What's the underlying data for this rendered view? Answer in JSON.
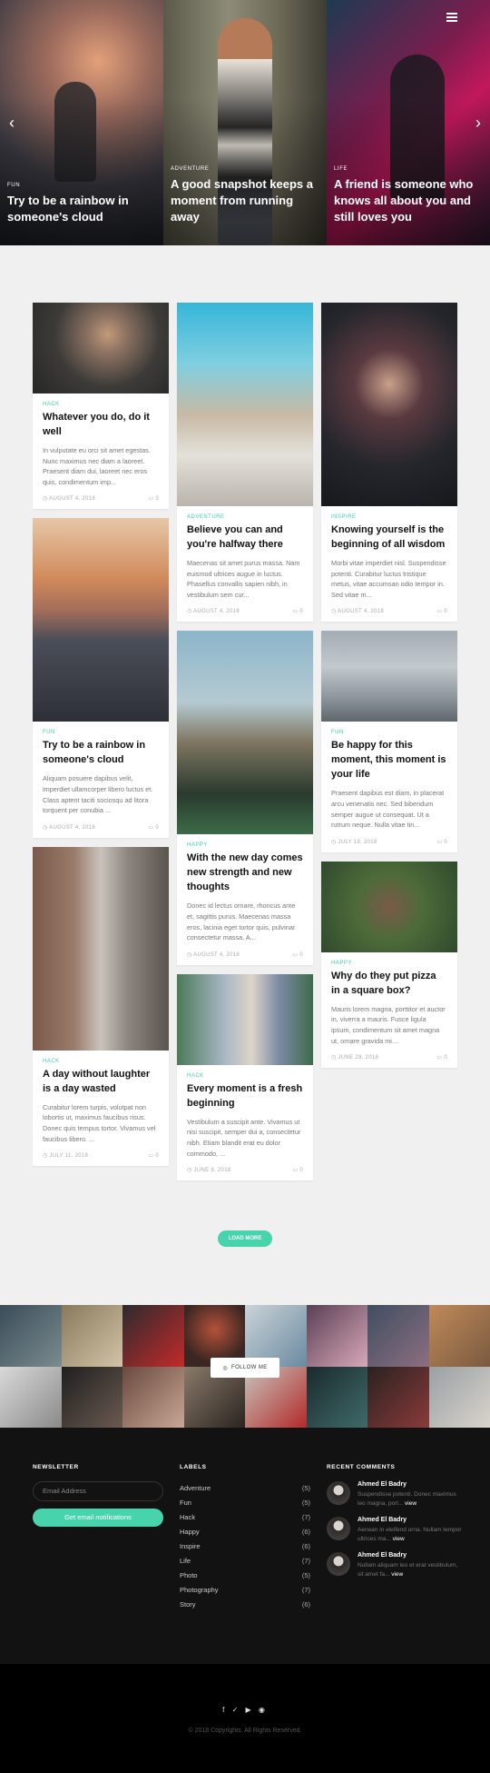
{
  "hero": {
    "slides": [
      {
        "category": "FUN",
        "title": "Try to be a rainbow in someone's cloud"
      },
      {
        "category": "ADVENTURE",
        "title": "A good snapshot keeps a moment from running away"
      },
      {
        "category": "LIFE",
        "title": "A friend is someone who knows all about you and still loves you"
      }
    ],
    "prev": "‹",
    "next": "›"
  },
  "posts": {
    "col1": [
      {
        "category": "HACK",
        "title": "Whatever you do, do it well",
        "excerpt": "In vulputate eu orci sit amet egestas. Nunc maximus nec diam a laoreet. Praesent diam dui, laoreet nec eros quis, condimentum imp...",
        "date": "AUGUST 4, 2018",
        "comments": "3"
      },
      {
        "category": "FUN",
        "title": "Try to be a rainbow in someone's cloud",
        "excerpt": "Aliquam posuere dapibus velit, imperdiet ullamcorper libero luctus et. Class aptent taciti sociosqu ad litora torquent per conubia ...",
        "date": "AUGUST 4, 2018",
        "comments": "0"
      },
      {
        "category": "HACK",
        "title": "A day without laughter is a day wasted",
        "excerpt": "Curabitur lorem turpis, volutpat non lobortis ut, maximus faucibus risus. Donec quis tempus tortor. Vivamus vel faucibus libero. ...",
        "date": "JULY 11, 2018",
        "comments": "0"
      }
    ],
    "col2": [
      {
        "category": "ADVENTURE",
        "title": "Believe you can and you're halfway there",
        "excerpt": "Maecenas sit amet purus massa. Nam euismod ultrices augue in luctus. Phasellus convallis sapien nibh, in vestibulum sem cur...",
        "date": "AUGUST 4, 2018",
        "comments": "0"
      },
      {
        "category": "HAPPY",
        "title": "With the new day comes new strength and new thoughts",
        "excerpt": "Donec id lectus ornare, rhoncus ante et, sagittis purus. Maecenas massa eros, lacinia eget tortor quis, pulvinar consectetur massa. A...",
        "date": "AUGUST 4, 2018",
        "comments": "0"
      },
      {
        "category": "HACK",
        "title": "Every moment is a fresh beginning",
        "excerpt": "Vestibulum a suscipit ante. Vivamus ut nisi suscipit, semper dui a, consectetur nibh. Etiam blandit erat eu dolor commodo, ...",
        "date": "JUNE 8, 2018",
        "comments": "0"
      }
    ],
    "col3": [
      {
        "category": "INSPIRE",
        "title": "Knowing yourself is the beginning of all wisdom",
        "excerpt": "Morbi vitae imperdiet nisl. Suspendisse potenti. Curabitur luctus tristique metus, vitae accumsan odio tempor in. Sed vitae m...",
        "date": "AUGUST 4, 2018",
        "comments": "0"
      },
      {
        "category": "FUN",
        "title": "Be happy for this moment, this moment is your life",
        "excerpt": "Praesent dapibus est diam, in placerat arcu venenatis nec. Sed bibendum semper augue ut consequat. Ut a rutrum neque. Nulla vitae tin...",
        "date": "JULY 18, 2018",
        "comments": "0"
      },
      {
        "category": "HAPPY",
        "title": "Why do they put pizza in a square box?",
        "excerpt": "Mauris lorem magna, porttitor et auctor in, viverra a mauris. Fusce ligula ipsum, condimentum sit amet magna ut, ornare gravida mi....",
        "date": "JUNE 29, 2018",
        "comments": "0"
      }
    ]
  },
  "load_more": "LOAD MORE",
  "instagram": {
    "follow": "FOLLOW ME"
  },
  "footer": {
    "newsletter": {
      "heading": "NEWSLETTER",
      "placeholder": "Email Address",
      "button": "Get email notifications"
    },
    "labels": {
      "heading": "LABELS",
      "items": [
        {
          "name": "Adventure",
          "count": "(5)"
        },
        {
          "name": "Fun",
          "count": "(5)"
        },
        {
          "name": "Hack",
          "count": "(7)"
        },
        {
          "name": "Happy",
          "count": "(6)"
        },
        {
          "name": "Inspire",
          "count": "(6)"
        },
        {
          "name": "Life",
          "count": "(7)"
        },
        {
          "name": "Photo",
          "count": "(5)"
        },
        {
          "name": "Photography",
          "count": "(7)"
        },
        {
          "name": "Story",
          "count": "(6)"
        }
      ]
    },
    "recent": {
      "heading": "RECENT COMMENTS",
      "items": [
        {
          "name": "Ahmed El Badry",
          "text": "Suspendisse potenti. Donec maximus leo magna, porl... ",
          "link": "view"
        },
        {
          "name": "Ahmed El Badry",
          "text": "Aenean in eleifend urna. Nullam tempor ultrices ma... ",
          "link": "view"
        },
        {
          "name": "Ahmed El Badry",
          "text": "Nullam aliquam leo et erat vestibulum, sit amet fa... ",
          "link": "view"
        }
      ]
    }
  },
  "bottom": {
    "social": "f ✓ ▶ ◉",
    "copyright": "© 2018 Copyrights. All Rights Reserved."
  }
}
